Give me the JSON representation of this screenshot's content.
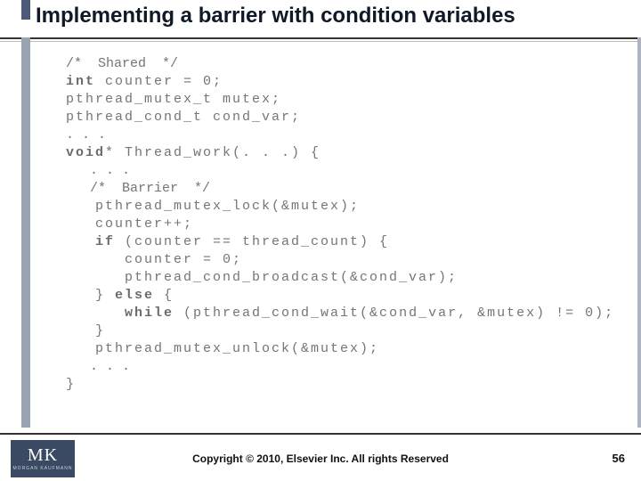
{
  "title": "Implementing a barrier with condition variables",
  "code": {
    "comment_shared": "/*  Shared  */",
    "int_decl": "int",
    "counter_init": " counter = 0;",
    "mutex_decl": "pthread_mutex_t mutex;",
    "cond_decl": "pthread_cond_t cond_var;",
    "dots1": ". . .",
    "voidkw": "void",
    "thread_sig": "* Thread_work(. . .) {",
    "dots2": "   . . .",
    "comment_barrier": "   /*  Barrier  */",
    "lock": "   pthread_mutex_lock(&mutex);",
    "incr": "   counter++;",
    "ifkw": "   if",
    "ifcond": " (counter == thread_count) {",
    "reset": "      counter = 0;",
    "broadcast": "      pthread_cond_broadcast(&cond_var);",
    "elseline_close": "   } ",
    "elsekw": "else",
    "elseline_open": " {",
    "whilekw": "      while",
    "whilecond": " (pthread_cond_wait(&cond_var, &mutex) != 0);",
    "close1": "   }",
    "unlock": "   pthread_mutex_unlock(&mutex);",
    "dots3": "   . . .",
    "close2": "}"
  },
  "footer": {
    "copyright": "Copyright © 2010, Elsevier Inc. All rights Reserved",
    "logo_text": "MK",
    "logo_sub": "MORGAN KAUFMANN",
    "page": "56"
  }
}
